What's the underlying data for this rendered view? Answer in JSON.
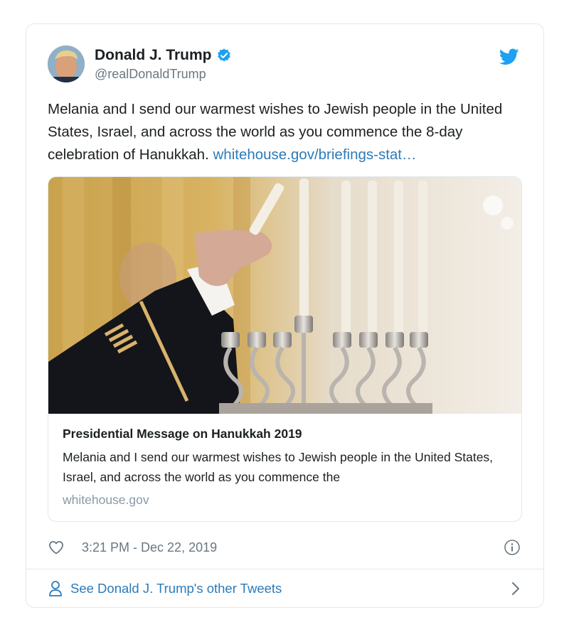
{
  "author": {
    "name": "Donald J. Trump",
    "handle": "@realDonaldTrump"
  },
  "tweet": {
    "text": "Melania and I send our warmest wishes to Jewish people in the United States, Israel, and across the world as you commence the 8-day celebration of Hanukkah. ",
    "link_text": "whitehouse.gov/briefings-stat…"
  },
  "card": {
    "title": "Presidential Message on Hanukkah 2019",
    "description": "Melania and I send our warmest wishes to Jewish people in the United States, Israel, and across the world as you commence the",
    "domain": "whitehouse.gov"
  },
  "meta": {
    "timestamp": "3:21 PM - Dec 22, 2019"
  },
  "footer": {
    "link_text": "See Donald J. Trump's other Tweets"
  },
  "colors": {
    "link": "#2b7bb9",
    "verified": "#1da1f2",
    "secondary_text": "#697882",
    "border": "#e1e8ed"
  },
  "icons": [
    "verified-badge-icon",
    "twitter-bird-icon",
    "heart-icon",
    "info-icon",
    "person-icon",
    "chevron-right-icon"
  ]
}
